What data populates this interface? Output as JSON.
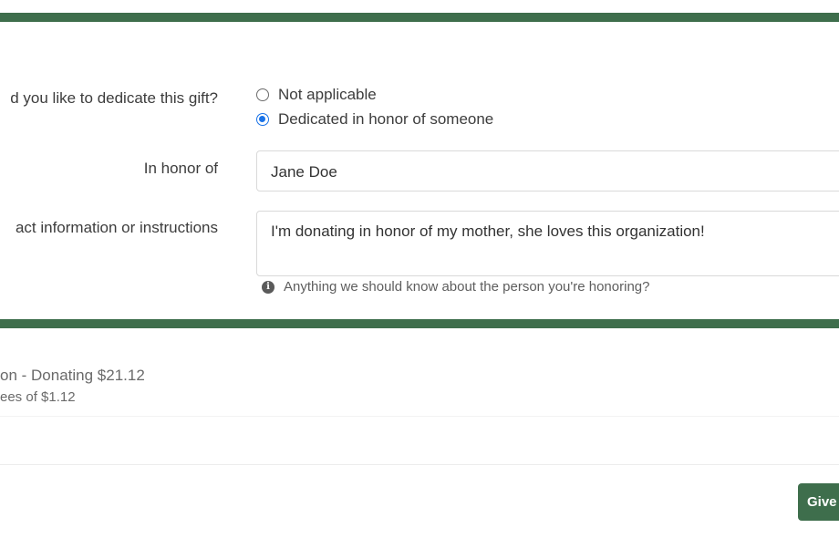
{
  "dedication": {
    "question_label": "d you like to dedicate this gift?",
    "options": [
      {
        "label": "Not applicable",
        "selected": false
      },
      {
        "label": "Dedicated in honor of someone",
        "selected": true
      }
    ]
  },
  "honor": {
    "label": "In honor of",
    "value": "Jane Doe"
  },
  "instructions": {
    "label": "act information or instructions",
    "value": "I'm donating in honor of my mother, she loves this organization!",
    "hint": "Anything we should know about the person you're honoring?",
    "hint_icon": "info-icon"
  },
  "summary": {
    "title": "on - Donating $21.12",
    "fees": "ees of $1.12"
  },
  "actions": {
    "give_label": "Give"
  },
  "colors": {
    "brand_green": "#3e6e4c",
    "radio_selected": "#1a73e8"
  }
}
